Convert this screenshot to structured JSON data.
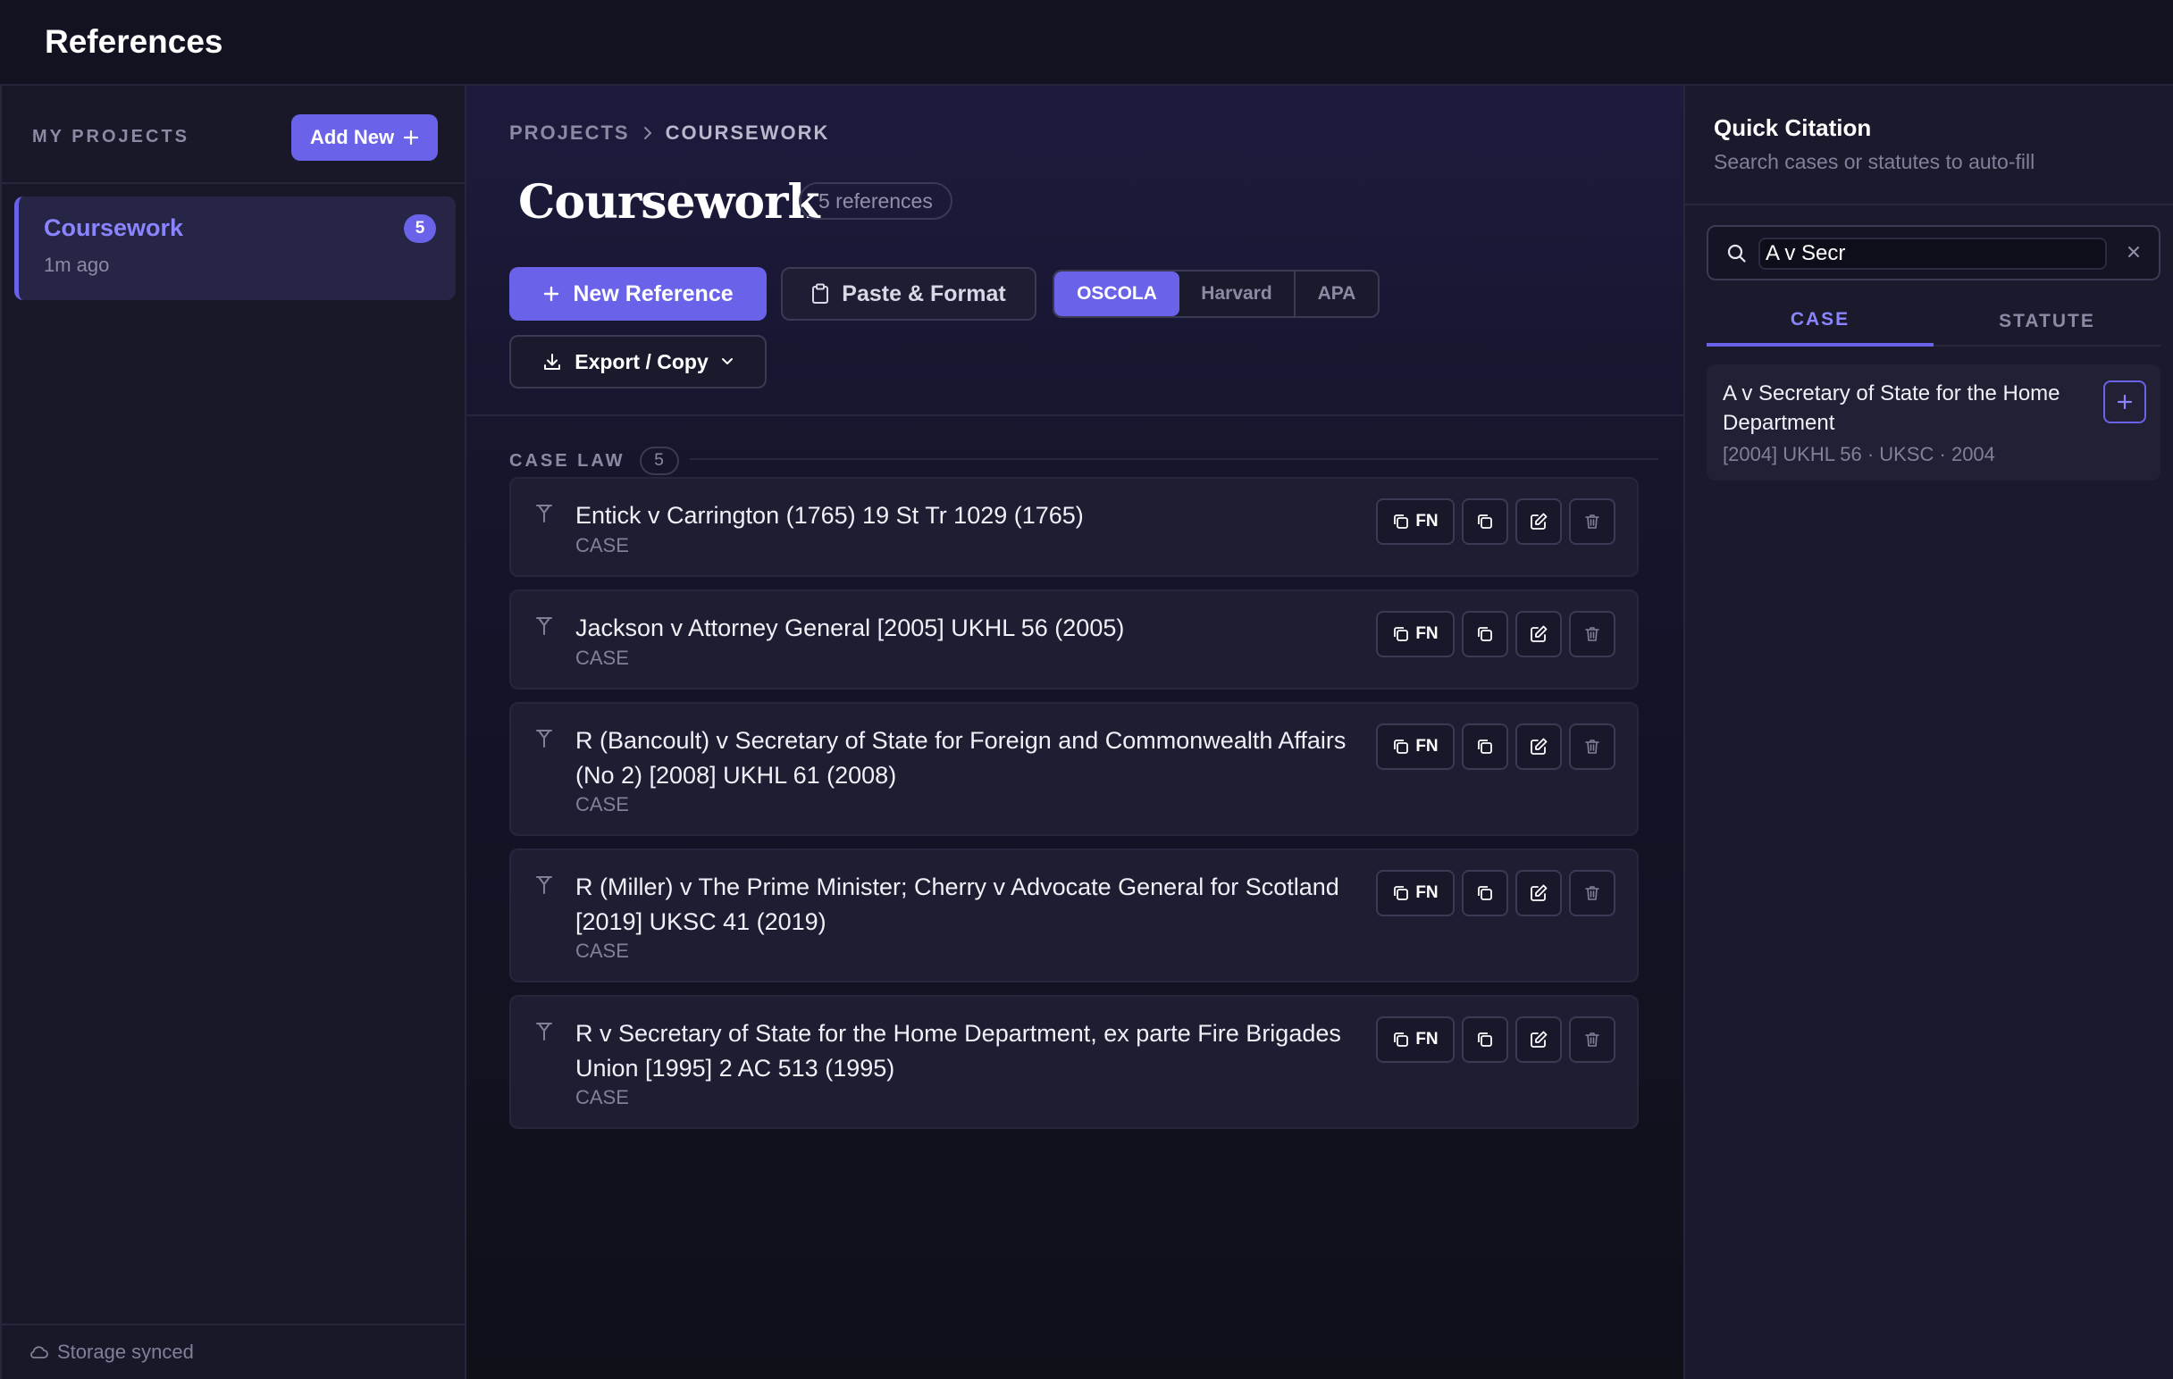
{
  "app": {
    "title": "References"
  },
  "sidebar": {
    "label": "MY PROJECTS",
    "add_new_label": "Add New",
    "projects": [
      {
        "name": "Coursework",
        "time": "1m ago",
        "count": "5"
      }
    ],
    "footer": "Storage synced"
  },
  "main": {
    "breadcrumb": [
      "PROJECTS",
      "COURSEWORK"
    ],
    "title": "Coursework",
    "ref_badge": "5 references",
    "toolbar": {
      "new_reference": "New Reference",
      "paste_format": "Paste & Format",
      "export_copy": "Export / Copy",
      "styles": [
        "OSCOLA",
        "Harvard",
        "APA"
      ],
      "active_style": "OSCOLA"
    },
    "section": {
      "label": "CASE LAW",
      "count": "5"
    },
    "fn_label": "FN",
    "references": [
      {
        "title": "Entick v Carrington (1765) 19 St Tr 1029 (1765)",
        "type": "CASE"
      },
      {
        "title": "Jackson v Attorney General [2005] UKHL 56 (2005)",
        "type": "CASE"
      },
      {
        "title": "R (Bancoult) v Secretary of State for Foreign and Commonwealth Affairs (No 2) [2008] UKHL 61 (2008)",
        "type": "CASE"
      },
      {
        "title": "R (Miller) v The Prime Minister; Cherry v Advocate General for Scotland [2019] UKSC 41 (2019)",
        "type": "CASE"
      },
      {
        "title": "R v Secretary of State for the Home Department, ex parte Fire Brigades Union [1995] 2 AC 513 (1995)",
        "type": "CASE"
      }
    ]
  },
  "quick_citation": {
    "title": "Quick Citation",
    "subtitle": "Search cases or statutes to auto-fill",
    "search_value": "A v Secr",
    "tabs": [
      "CASE",
      "STATUTE"
    ],
    "active_tab": "CASE",
    "results": [
      {
        "title": "A v Secretary of State for the Home Department",
        "meta": "[2004] UKHL 56 · UKSC · 2004"
      }
    ]
  },
  "colors": {
    "accent": "#6a62e8",
    "accent_text": "#8b84ff",
    "background": "#12121f",
    "panel": "#1a1a2c"
  },
  "icons": [
    "plus-icon",
    "clipboard-icon",
    "download-icon",
    "chevron-down-icon",
    "gavel-icon",
    "copy-icon",
    "edit-icon",
    "trash-icon",
    "search-icon",
    "close-icon",
    "cloud-icon"
  ]
}
